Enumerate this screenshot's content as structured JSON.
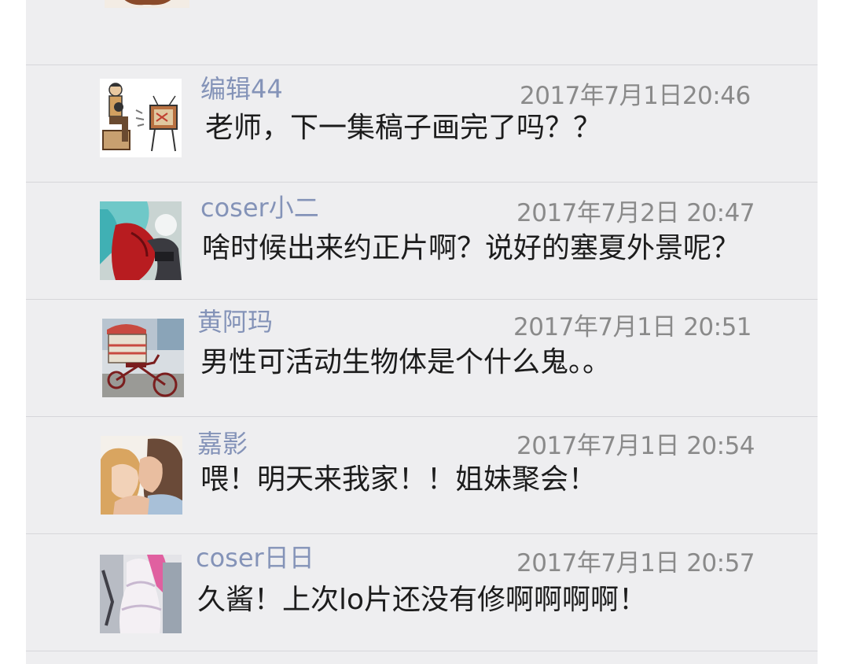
{
  "comments": [
    {
      "name": "编辑44",
      "time": "2017年7月1日20:46",
      "text": "老师，下一集稿子画完了吗？？",
      "avatar_icon": "man-watching-tv-icon"
    },
    {
      "name": "coser小二",
      "time": "2017年7月2日 20:47",
      "text": "啥时候出来约正片啊？说好的塞夏外景呢？",
      "avatar_icon": "cosplayer-photo-icon"
    },
    {
      "name": "黄阿玛",
      "time": "2017年7月1日 20:51",
      "text": "男性可活动生物体是个什么鬼。。",
      "avatar_icon": "cargo-tricycle-icon"
    },
    {
      "name": "嘉影",
      "time": "2017年7月1日 20:54",
      "text": "喂！明天来我家！！姐妹聚会！",
      "avatar_icon": "kissing-couple-icon"
    },
    {
      "name": "coser日日",
      "time": "2017年7月1日 20:57",
      "text": "久酱！上次lo片还没有修啊啊啊啊！",
      "avatar_icon": "lolita-dress-photo-icon"
    }
  ],
  "colors": {
    "panel_bg": "#eeeef0",
    "name": "#8493b8",
    "time": "#8a8a8a",
    "text": "#1c1c1c",
    "divider": "#d6d6da"
  }
}
